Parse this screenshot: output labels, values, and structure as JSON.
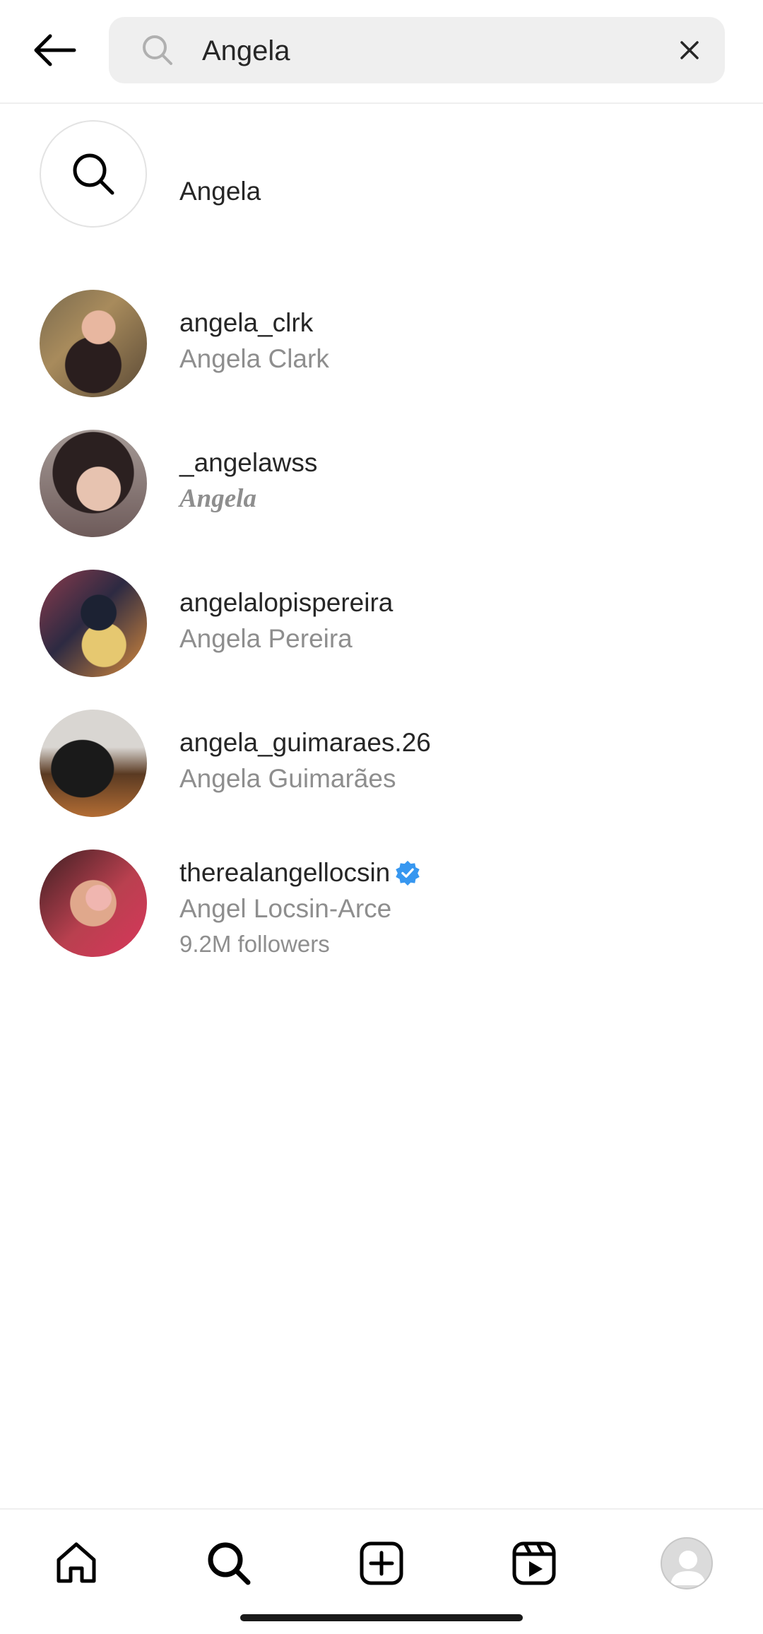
{
  "search": {
    "query": "Angela",
    "placeholder": "Search"
  },
  "results": {
    "keyword_row": {
      "label": "Angela",
      "icon": "search-icon"
    },
    "accounts": [
      {
        "username": "angela_clrk",
        "full_name": "Angela Clark",
        "verified": false
      },
      {
        "username": "_angelawss",
        "full_name": "Angela",
        "verified": false
      },
      {
        "username": "angelalopispereira",
        "full_name": "Angela Pereira",
        "verified": false
      },
      {
        "username": "angela_guimaraes.26",
        "full_name": "Angela Guimarães",
        "verified": false
      },
      {
        "username": "therealangellocsin",
        "full_name": "Angel Locsin-Arce",
        "followers": "9.2M followers",
        "verified": true
      }
    ]
  },
  "nav": {
    "items": [
      "home-icon",
      "search-icon",
      "create-icon",
      "reels-icon",
      "profile-avatar"
    ]
  },
  "colors": {
    "primary_text": "#262626",
    "secondary_text": "#8e8e8e",
    "search_bg": "#efefef",
    "verified_blue": "#3797f0"
  }
}
